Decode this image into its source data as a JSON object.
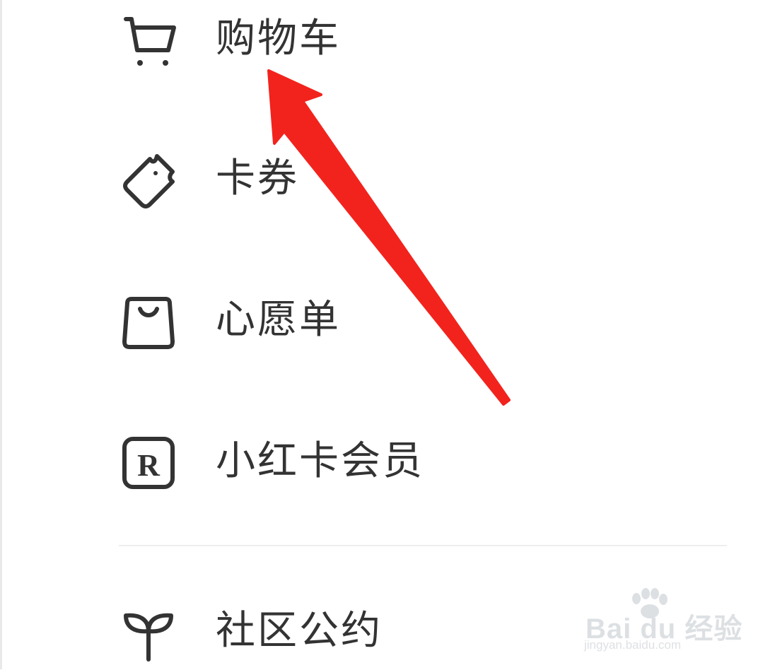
{
  "menu": {
    "items": [
      {
        "label": "购物车",
        "icon": "shopping-cart-icon"
      },
      {
        "label": "卡券",
        "icon": "ticket-icon"
      },
      {
        "label": "心愿单",
        "icon": "shopping-bag-icon"
      },
      {
        "label": "小红卡会员",
        "icon": "member-r-icon"
      }
    ],
    "community": {
      "label": "社区公约",
      "icon": "sprout-icon"
    },
    "member_icon_letter": "R"
  },
  "annotation": {
    "type": "arrow",
    "color": "#f2231d",
    "target": "购物车"
  },
  "watermark": {
    "brand": "Bai du 经验",
    "url": "jingyan.baidu.com"
  },
  "colors": {
    "text": "#333333",
    "icon": "#333333",
    "divider": "#eeeeee",
    "background": "#ffffff"
  }
}
